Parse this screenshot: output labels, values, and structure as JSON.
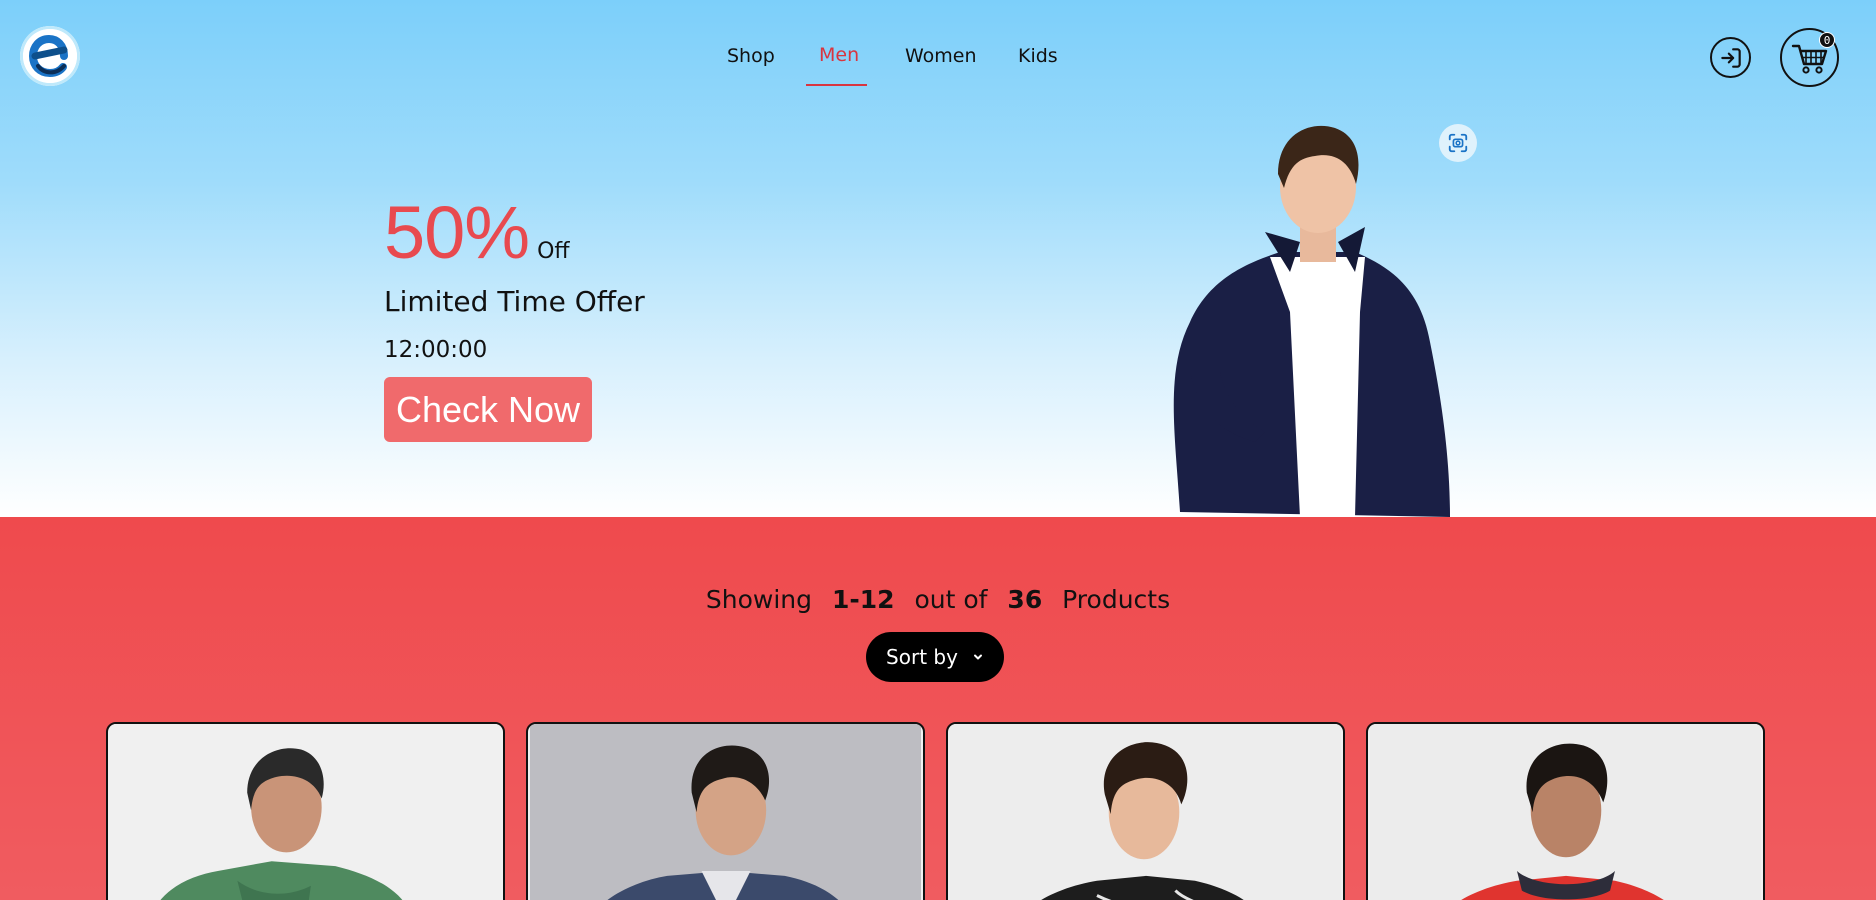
{
  "nav": {
    "items": [
      {
        "label": "Shop",
        "active": false
      },
      {
        "label": "Men",
        "active": true
      },
      {
        "label": "Women",
        "active": false
      },
      {
        "label": "Kids",
        "active": false
      }
    ]
  },
  "header": {
    "logo_icon": "e-logo-icon",
    "login_icon": "login-icon",
    "cart_icon": "shopping-cart-icon",
    "cart_count": "0"
  },
  "hero": {
    "discount": "50%",
    "discount_suffix": "Off",
    "title": "Limited Time Offer",
    "timer": "12:00:00",
    "cta_label": "Check Now",
    "scan_icon": "visual-search-icon"
  },
  "listing": {
    "showing_prefix": "Showing",
    "range": "1-12",
    "out_of": "out of",
    "total": "36",
    "suffix": "Products",
    "sort_label": "Sort by",
    "sort_icon": "chevron-down-icon"
  },
  "products": [
    {
      "name": "product-card-1",
      "jacket_color": "#4f8a5f"
    },
    {
      "name": "product-card-2",
      "jacket_color": "#3b4a6b"
    },
    {
      "name": "product-card-3",
      "jacket_color": "#1d1d1d"
    },
    {
      "name": "product-card-4",
      "jacket_color": "#e0342f"
    }
  ],
  "colors": {
    "accent_red": "#d9353f",
    "cta": "#f06a6c",
    "sky": "#7ccffa",
    "section_red": "#ef4a4d"
  }
}
